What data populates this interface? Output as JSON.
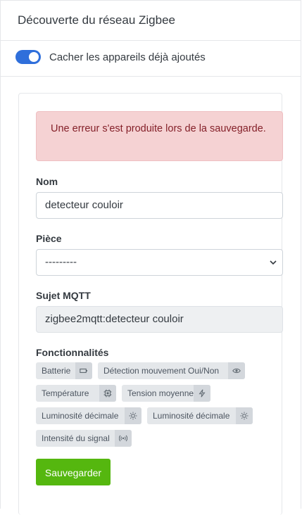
{
  "header": {
    "title": "Découverte du réseau Zigbee"
  },
  "toggle": {
    "label": "Cacher les appareils déjà ajoutés",
    "checked": true
  },
  "alert": {
    "message": "Une erreur s'est produite lors de la sauvegarde."
  },
  "form": {
    "name": {
      "label": "Nom",
      "value": "detecteur couloir"
    },
    "room": {
      "label": "Pièce",
      "value": "---------"
    },
    "mqtt": {
      "label": "Sujet MQTT",
      "value": "zigbee2mqtt:detecteur couloir"
    },
    "features": {
      "label": "Fonctionnalités",
      "items": [
        {
          "label": "Batterie",
          "icon": "battery-icon"
        },
        {
          "label": "Détection mouvement Oui/Non",
          "icon": "eye-icon"
        },
        {
          "label": "Température",
          "icon": "thermometer-icon"
        },
        {
          "label": "Tension moyenne",
          "icon": "bolt-icon"
        },
        {
          "label": "Luminosité décimale",
          "icon": "sun-icon"
        },
        {
          "label": "Luminosité décimale",
          "icon": "sun-icon"
        },
        {
          "label": "Intensité du signal",
          "icon": "signal-icon"
        }
      ]
    },
    "save_label": "Sauvegarder"
  },
  "colors": {
    "accent": "#2f6fdb",
    "save_button": "#55b70f",
    "alert_bg": "#f5d2d3",
    "alert_text": "#842029"
  }
}
